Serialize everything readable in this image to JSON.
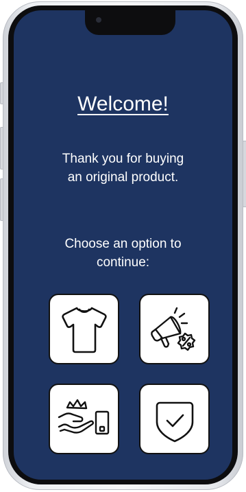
{
  "screen": {
    "title": "Welcome!",
    "subtitle_line1": "Thank you for buying",
    "subtitle_line2": "an original product.",
    "prompt_line1": "Choose an option to",
    "prompt_line2": "continue:"
  },
  "options": [
    {
      "icon": "t-shirt-icon"
    },
    {
      "icon": "megaphone-discount-icon"
    },
    {
      "icon": "hand-crown-phone-icon"
    },
    {
      "icon": "shield-check-icon"
    }
  ],
  "colors": {
    "screen_background": "#1e3461",
    "text": "#ffffff",
    "tile_background": "#ffffff",
    "tile_border": "#111111"
  }
}
